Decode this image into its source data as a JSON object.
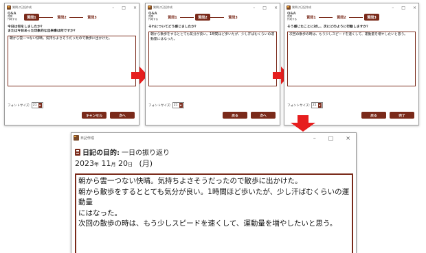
{
  "colors": {
    "accent": "#7a2a1a",
    "arrow": "#e61e1e"
  },
  "win1": {
    "title": "質問ぷ日記作成",
    "step_icon_caption_1": "質問",
    "step_icon_caption_2": "作成する",
    "step_icon_glyph": "Q&A",
    "steps": [
      "質問1",
      "質問2",
      "質問3"
    ],
    "question": [
      "今日は何をしましたか？",
      "または今日あった印象的な出来事は何ですか？"
    ],
    "answer": "朝から雲一つない快晴。気持ちよさそうだったので散歩に出かけた。",
    "font_label": "フォントサイズ:",
    "font_value": "21",
    "buttons": [
      "キャンセル",
      "次へ"
    ]
  },
  "win2": {
    "title": "質問ぷ日記作成",
    "step_icon_caption_1": "質問",
    "step_icon_caption_2": "作成する",
    "step_icon_glyph": "Q&A",
    "steps": [
      "質問1",
      "質問2",
      "質問3"
    ],
    "question": [
      "それについてどう感じましたか？"
    ],
    "answer": "朝から散歩をするととても気分が良い。1時間ほど歩いたが、少し汗ばむくらいの運動量にはなった。",
    "font_label": "フォントサイズ:",
    "font_value": "21",
    "buttons": [
      "戻る",
      "次へ"
    ]
  },
  "win3": {
    "title": "質問ぷ日記作成",
    "step_icon_caption_1": "質問",
    "step_icon_caption_2": "作成する",
    "step_icon_glyph": "Q&A",
    "steps": [
      "質問1",
      "質問2",
      "質問3"
    ],
    "question": [
      "そう感じたことに対し、次にどのように行動しますか？"
    ],
    "answer": "次回の散歩の時は、もう少しスピードを速くして、運動量を増やしたいと思う。",
    "font_label": "フォントサイズ:",
    "font_value": "21",
    "buttons": [
      "戻る",
      "完了"
    ]
  },
  "diary": {
    "title": "日記作成",
    "purpose_label": "日記の目的:",
    "purpose_value": "一日の振り返り",
    "date": {
      "year": "2023",
      "year_unit": "年",
      "month": "11",
      "month_unit": "月",
      "day": "20",
      "day_unit": "日",
      "weekday": "(月)"
    },
    "lines": [
      "朝から雲一つない快晴。気持ちよさそうだったので散歩に出かけた。",
      "朝から散歩をするととても気分が良い。1時間ほど歩いたが、少し汗ばむくらいの運動量",
      "にはなった。",
      "次回の散歩の時は、もう少しスピードを速くして、運動量を増やしたいと思う。"
    ]
  },
  "window_controls": [
    "–",
    "□",
    "×"
  ]
}
